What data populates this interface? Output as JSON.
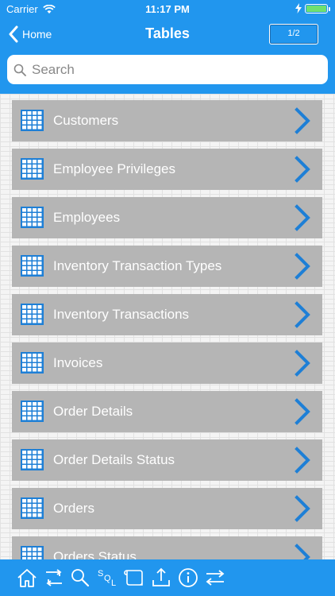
{
  "status": {
    "carrier": "Carrier",
    "time": "11:17 PM"
  },
  "nav": {
    "back_label": "Home",
    "title": "Tables",
    "page_indicator": "1/2"
  },
  "search": {
    "placeholder": "Search",
    "value": ""
  },
  "tables": [
    {
      "label": "Customers"
    },
    {
      "label": "Employee Privileges"
    },
    {
      "label": "Employees"
    },
    {
      "label": "Inventory Transaction Types"
    },
    {
      "label": "Inventory Transactions"
    },
    {
      "label": "Invoices"
    },
    {
      "label": "Order Details"
    },
    {
      "label": "Order Details Status"
    },
    {
      "label": "Orders"
    },
    {
      "label": "Orders Status"
    }
  ],
  "toolbar": {
    "items": [
      "home-icon",
      "sync-icon",
      "search-icon",
      "sql-icon",
      "scroll-icon",
      "export-icon",
      "info-icon",
      "swap-icon"
    ],
    "sql_text": "SQL"
  },
  "colors": {
    "accent": "#2196ee",
    "row": "#b5b5b5",
    "icon": "#1e7fd6"
  }
}
